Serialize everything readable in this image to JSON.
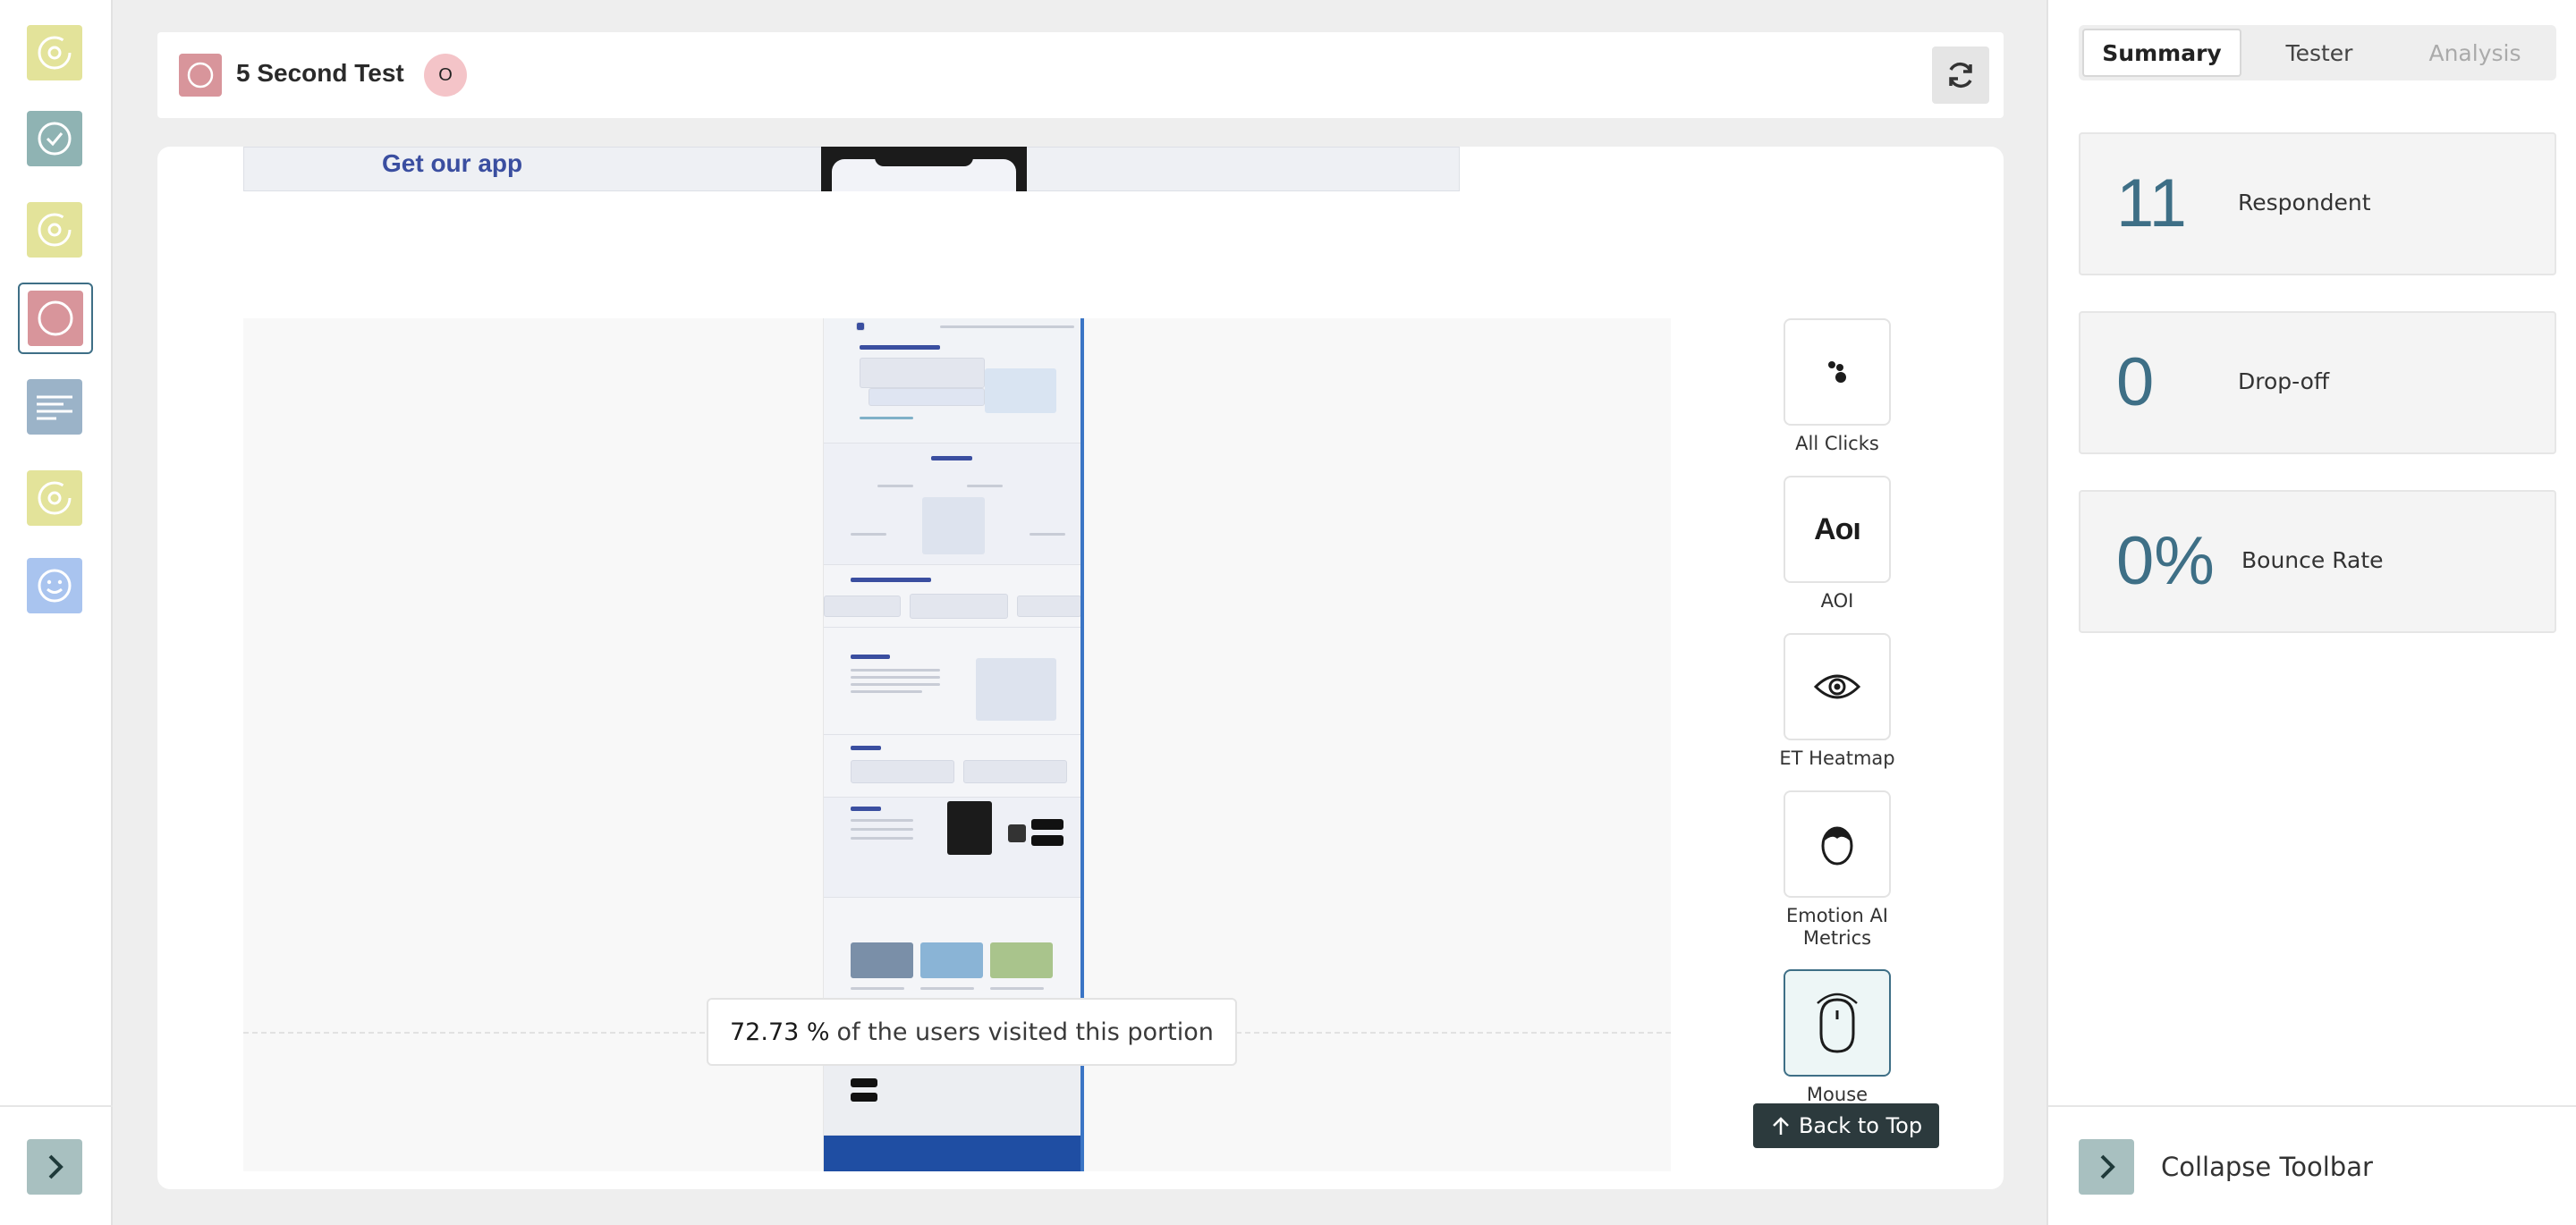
{
  "header": {
    "title": "5 Second Test",
    "badge": "O"
  },
  "left_rail": {
    "items": [
      {
        "icon": "target-icon",
        "color": "#e3e39a"
      },
      {
        "icon": "check-circle-icon",
        "color": "#8fb3b3"
      },
      {
        "icon": "target-icon",
        "color": "#e3e39a"
      },
      {
        "icon": "circle-icon",
        "color": "#d8959b",
        "active": true
      },
      {
        "icon": "text-lines-icon",
        "color": "#9bb3c8"
      },
      {
        "icon": "target-icon",
        "color": "#e3e39a"
      },
      {
        "icon": "smiley-icon",
        "color": "#a9c4ef"
      }
    ],
    "expand_icon": "chevron-right-icon"
  },
  "preview": {
    "top_strip_text": "Get our app",
    "visit_percent": "72.73 %",
    "visit_text": "of the users visited this portion",
    "visit_fraction": 0.7273
  },
  "tools": [
    {
      "label": "All Clicks",
      "icon": "dots-icon"
    },
    {
      "label": "AOI",
      "icon": "aoi-text-icon",
      "icon_text": "Aoı"
    },
    {
      "label": "ET Heatmap",
      "icon": "eye-icon"
    },
    {
      "label": "Emotion AI Metrics",
      "icon": "face-icon"
    },
    {
      "label": "Mouse",
      "icon": "mouse-icon",
      "active": true
    }
  ],
  "back_to_top": "Back to Top",
  "right_panel": {
    "tabs": [
      {
        "label": "Summary",
        "active": true
      },
      {
        "label": "Tester",
        "active": false
      },
      {
        "label": "Analysis",
        "disabled": true
      }
    ],
    "stats": [
      {
        "value": "11",
        "label": "Respondent"
      },
      {
        "value": "0",
        "label": "Drop-off"
      },
      {
        "value": "0%",
        "label": "Bounce Rate"
      }
    ],
    "collapse_label": "Collapse Toolbar"
  },
  "colors": {
    "accent": "#3e6f86",
    "active_test": "#d8959b",
    "dark_button": "#2c3a3d"
  }
}
